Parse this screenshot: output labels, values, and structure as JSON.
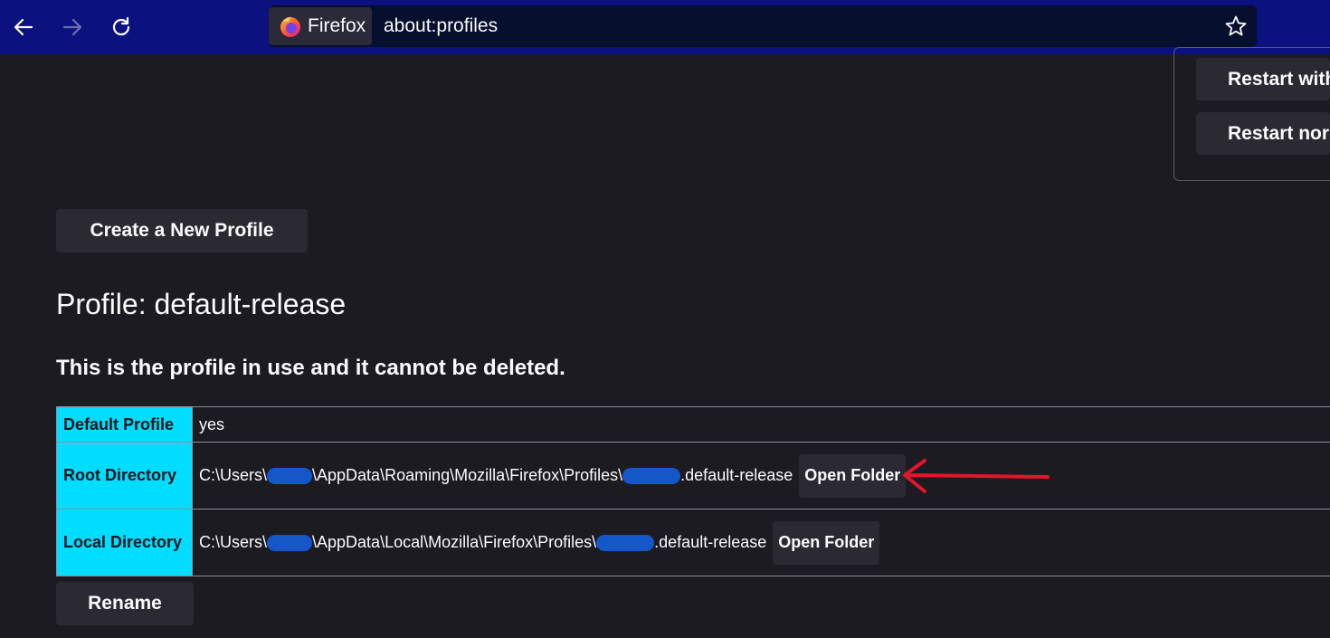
{
  "browser": {
    "identity_label": "Firefox",
    "url": "about:profiles"
  },
  "top_buttons": {
    "restart_with": "Restart with",
    "restart_normally": "Restart nor"
  },
  "create_profile_label": "Create a New Profile",
  "profile": {
    "title": "Profile: default-release",
    "in_use_note": "This is the profile in use and it cannot be deleted.",
    "rows": {
      "default": {
        "label": "Default Profile",
        "value": "yes"
      },
      "root": {
        "label": "Root Directory",
        "path_start": "C:\\Users\\",
        "path_mid": "\\AppData\\Roaming\\Mozilla\\Firefox\\Profiles\\",
        "path_end": ".default-release",
        "button": "Open Folder"
      },
      "local": {
        "label": "Local Directory",
        "path_start": "C:\\Users\\",
        "path_mid": "\\AppData\\Local\\Mozilla\\Firefox\\Profiles\\",
        "path_end": ".default-release",
        "button": "Open Folder"
      }
    }
  },
  "rename_label": "Rename",
  "colors": {
    "toolbar": "#0c1180",
    "page_bg": "#1c1b22",
    "table_header": "#00ddff",
    "annotation_arrow": "#e0162b",
    "redaction": "#1556c9"
  }
}
